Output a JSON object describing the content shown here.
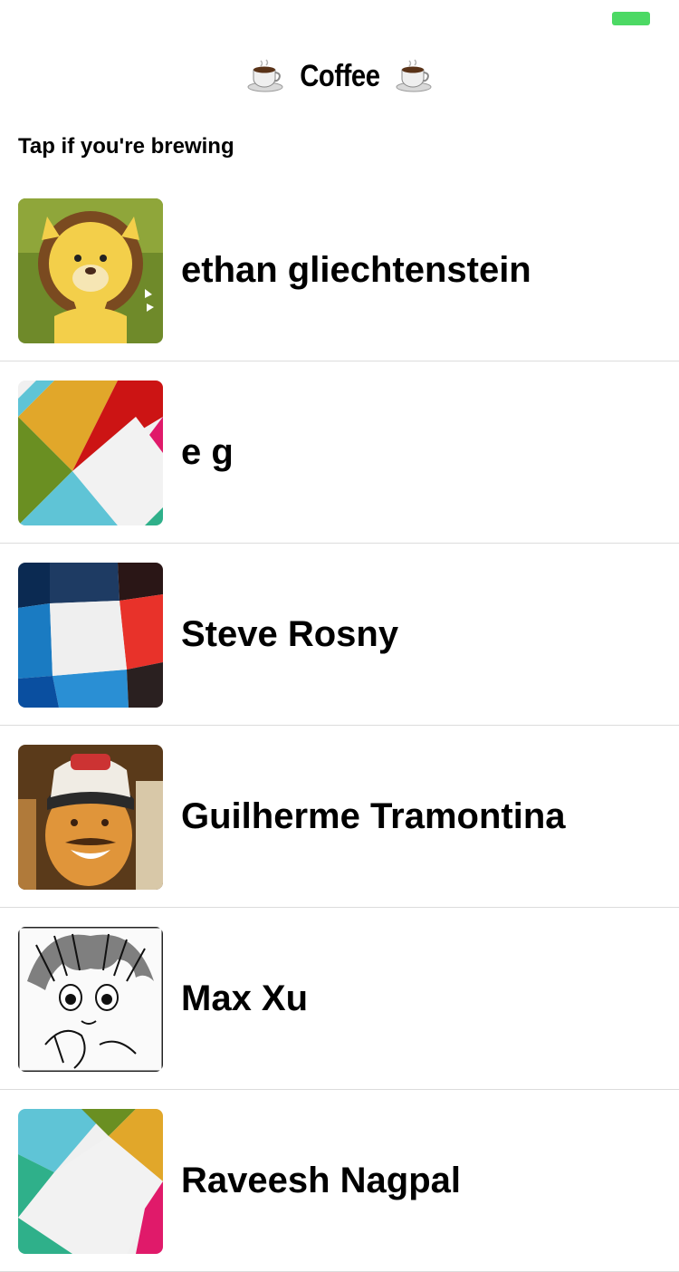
{
  "header": {
    "title": "Coffee",
    "left_icon": "coffee-cup-icon",
    "right_icon": "coffee-cup-icon"
  },
  "status_bar": {
    "battery_color": "#4cd964"
  },
  "section": {
    "label": "Tap if you're brewing"
  },
  "users": [
    {
      "name": "ethan gliechtenstein",
      "avatar": "cartoon-lion-avatar"
    },
    {
      "name": "e g",
      "avatar": "geometric-pattern-avatar"
    },
    {
      "name": "Steve Rosny",
      "avatar": "geometric-pattern-avatar"
    },
    {
      "name": "Guilherme Tramontina",
      "avatar": "photo-avatar"
    },
    {
      "name": "Max Xu",
      "avatar": "manga-drawing-avatar"
    },
    {
      "name": "Raveesh Nagpal",
      "avatar": "geometric-pattern-avatar"
    }
  ]
}
